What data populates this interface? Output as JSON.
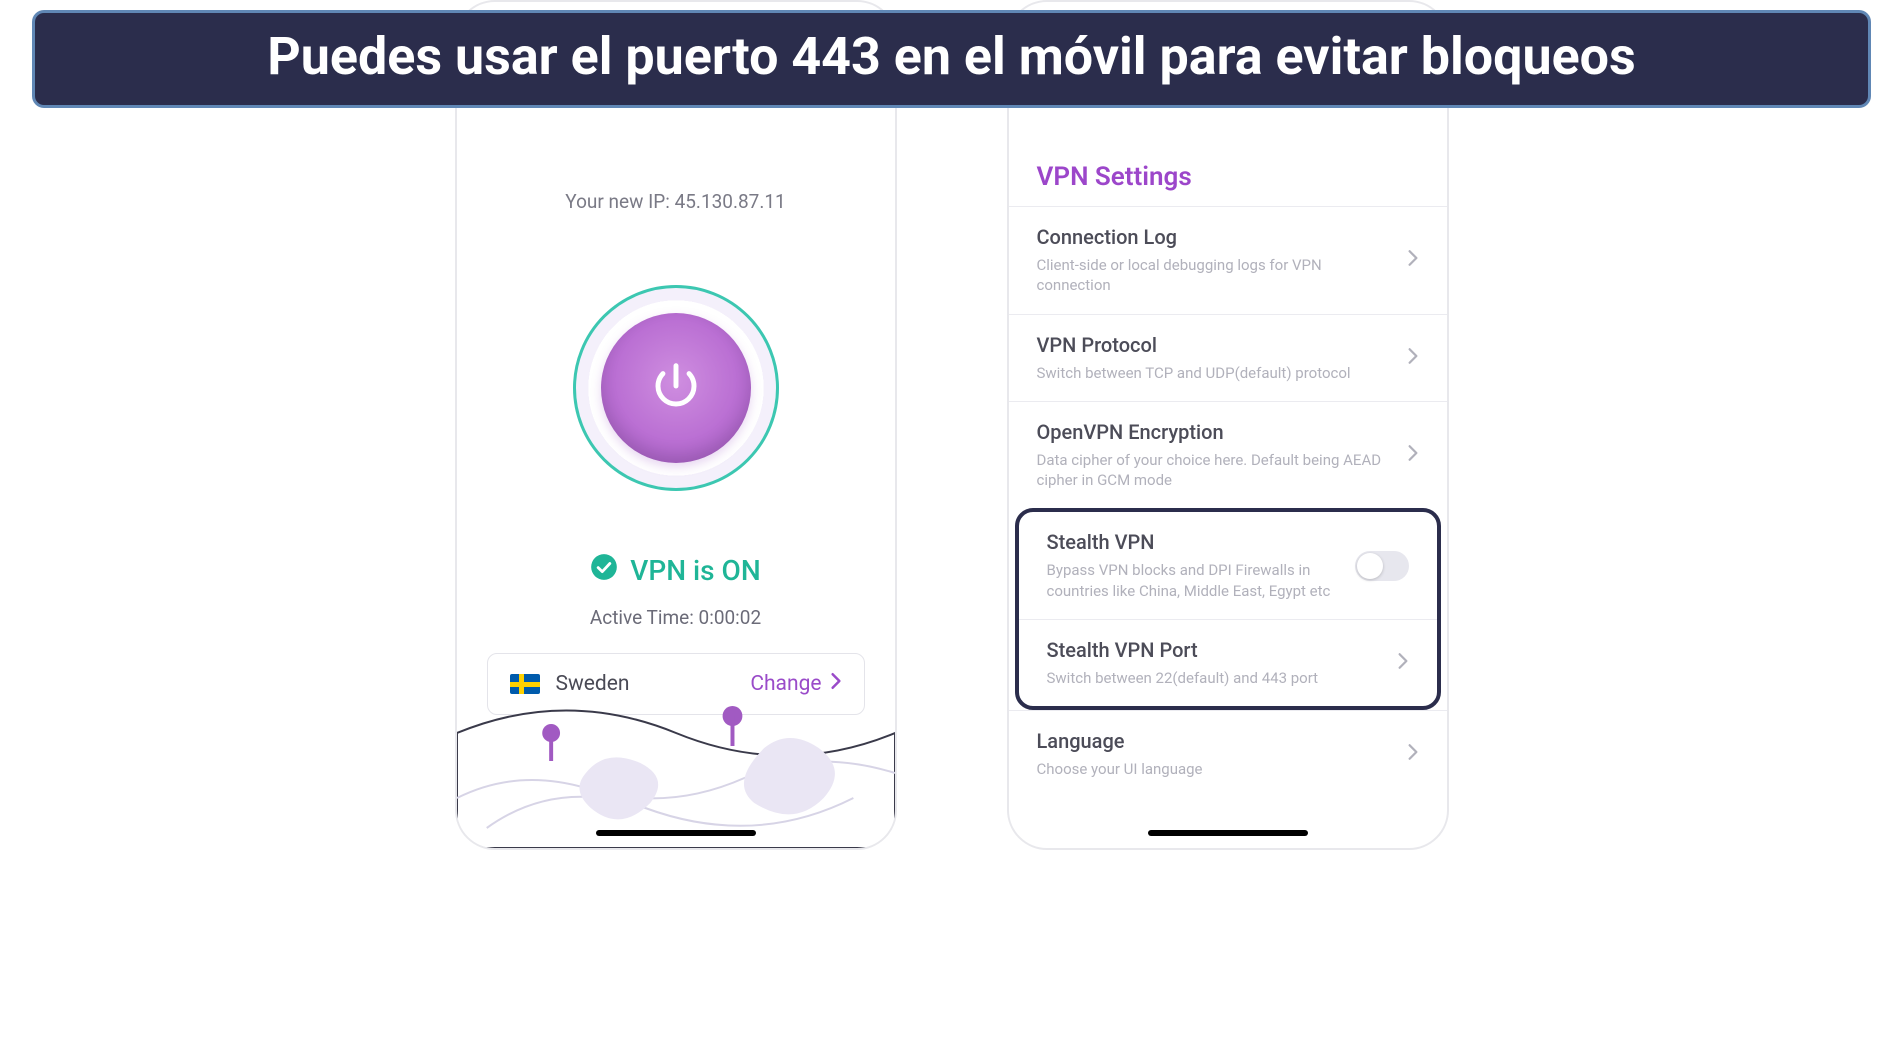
{
  "banner": {
    "text": "Puedes usar el puerto 443 en el móvil para evitar bloqueos"
  },
  "left": {
    "ip_label": "Your new IP: 45.130.87.11",
    "status": "VPN is ON",
    "active_time": "Active Time: 0:00:02",
    "country": "Sweden",
    "change_label": "Change"
  },
  "settings": {
    "title": "VPN Settings",
    "rows": [
      {
        "title": "Connection Log",
        "desc": "Client-side or local debugging logs for VPN connection"
      },
      {
        "title": "VPN Protocol",
        "desc": "Switch between TCP and UDP(default) protocol"
      },
      {
        "title": "OpenVPN Encryption",
        "desc": "Data cipher of your choice here. Default being AEAD cipher in GCM mode"
      },
      {
        "title": "Stealth VPN",
        "desc": "Bypass VPN blocks and DPI Firewalls in countries like China, Middle East, Egypt etc"
      },
      {
        "title": "Stealth VPN Port",
        "desc": "Switch between 22(default) and 443 port"
      },
      {
        "title": "Language",
        "desc": "Choose your UI language"
      }
    ]
  }
}
